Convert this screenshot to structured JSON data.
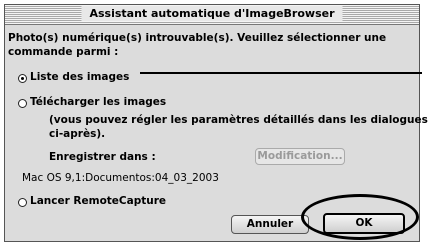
{
  "dialog": {
    "title": "Assistant automatique d'ImageBrowser",
    "message_line1": "Photo(s) numérique(s) introuvable(s). Veuillez sélectionner une",
    "message_line2": "commande parmi :",
    "options": {
      "list_images": {
        "label": "Liste des images",
        "selected": true
      },
      "download_images": {
        "label": "Télécharger les images",
        "selected": false
      },
      "launch_remotecapture": {
        "label": "Lancer RemoteCapture",
        "selected": false
      }
    },
    "download_note_line1": "(vous pouvez régler les paramètres détaillés dans les dialogues",
    "download_note_line2": "ci-après).",
    "save_to_label": "Enregistrer dans :",
    "modify_button": "Modification...",
    "save_path": "Mac OS 9,1:Documentos:04_03_2003",
    "cancel_button": "Annuler",
    "ok_button": "OK"
  }
}
